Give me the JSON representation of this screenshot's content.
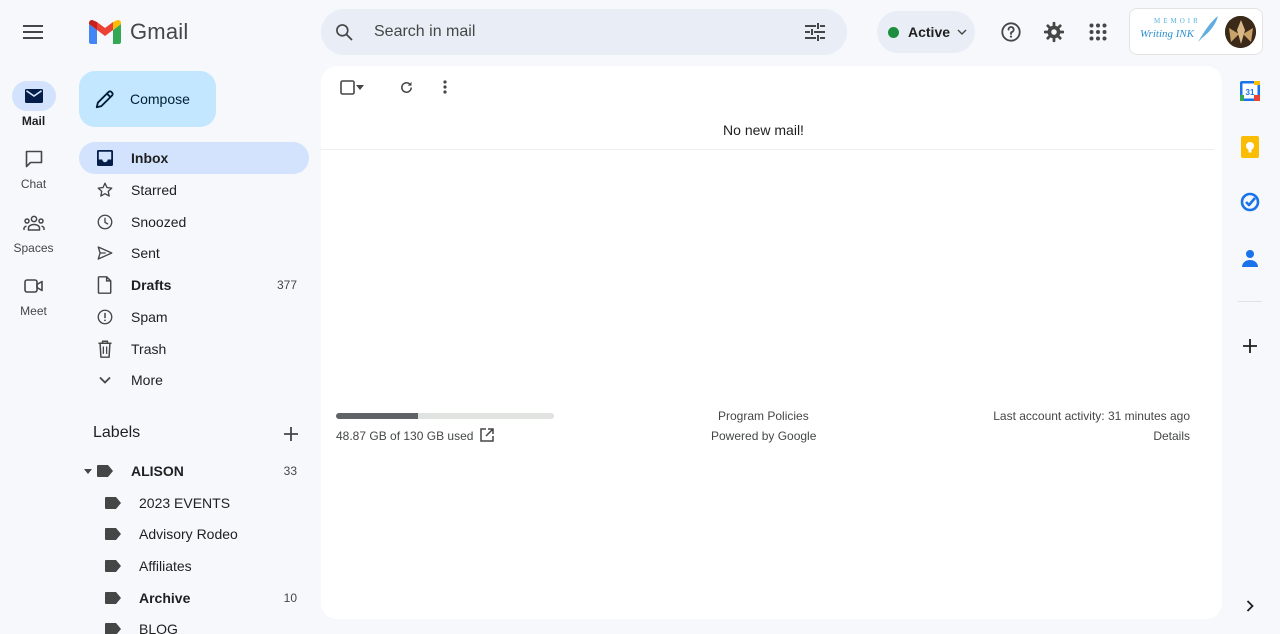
{
  "app": {
    "name": "Gmail"
  },
  "rail": {
    "items": [
      {
        "label": "Mail",
        "icon": "mail-icon",
        "active": true
      },
      {
        "label": "Chat",
        "icon": "chat-icon"
      },
      {
        "label": "Spaces",
        "icon": "spaces-icon"
      },
      {
        "label": "Meet",
        "icon": "meet-icon"
      }
    ]
  },
  "search": {
    "placeholder": "Search in mail"
  },
  "status": {
    "label": "Active",
    "color": "#1e8e3e"
  },
  "account": {
    "logo_text_top": "MEMOIR",
    "logo_text_bottom": "Writing INK"
  },
  "compose": {
    "label": "Compose"
  },
  "nav": {
    "items": [
      {
        "label": "Inbox",
        "icon": "inbox-icon",
        "active": true,
        "bold": true,
        "count": ""
      },
      {
        "label": "Starred",
        "icon": "star-icon",
        "count": ""
      },
      {
        "label": "Snoozed",
        "icon": "clock-icon",
        "count": ""
      },
      {
        "label": "Sent",
        "icon": "send-icon",
        "count": ""
      },
      {
        "label": "Drafts",
        "icon": "draft-icon",
        "bold": true,
        "count": "377"
      },
      {
        "label": "Spam",
        "icon": "spam-icon",
        "count": ""
      },
      {
        "label": "Trash",
        "icon": "trash-icon",
        "count": ""
      },
      {
        "label": "More",
        "icon": "chevron-down-icon",
        "count": ""
      }
    ]
  },
  "labels": {
    "title": "Labels",
    "items": [
      {
        "label": "ALISON",
        "bold": true,
        "count": "33",
        "expanded": true
      },
      {
        "label": "2023 EVENTS",
        "count": ""
      },
      {
        "label": "Advisory Rodeo",
        "count": ""
      },
      {
        "label": "Affiliates",
        "count": ""
      },
      {
        "label": "Archive",
        "bold": true,
        "count": "10"
      },
      {
        "label": "BLOG",
        "count": ""
      }
    ]
  },
  "main": {
    "empty_message": "No new mail!",
    "storage": {
      "text": "48.87 GB of 130 GB used",
      "used_fraction": 0.376
    },
    "footer": {
      "policies": "Program Policies",
      "powered": "Powered by Google",
      "last_activity": "Last account activity: 31 minutes ago",
      "details": "Details"
    }
  },
  "side_panel": {
    "apps": [
      "calendar-icon",
      "keep-icon",
      "tasks-icon",
      "contacts-icon",
      "add-icon"
    ],
    "calendar_day": "31"
  },
  "colors": {
    "accent": "#0b57d0",
    "nav_active": "#d3e3fd",
    "compose": "#c2e7ff",
    "background": "#f6f8fc"
  }
}
